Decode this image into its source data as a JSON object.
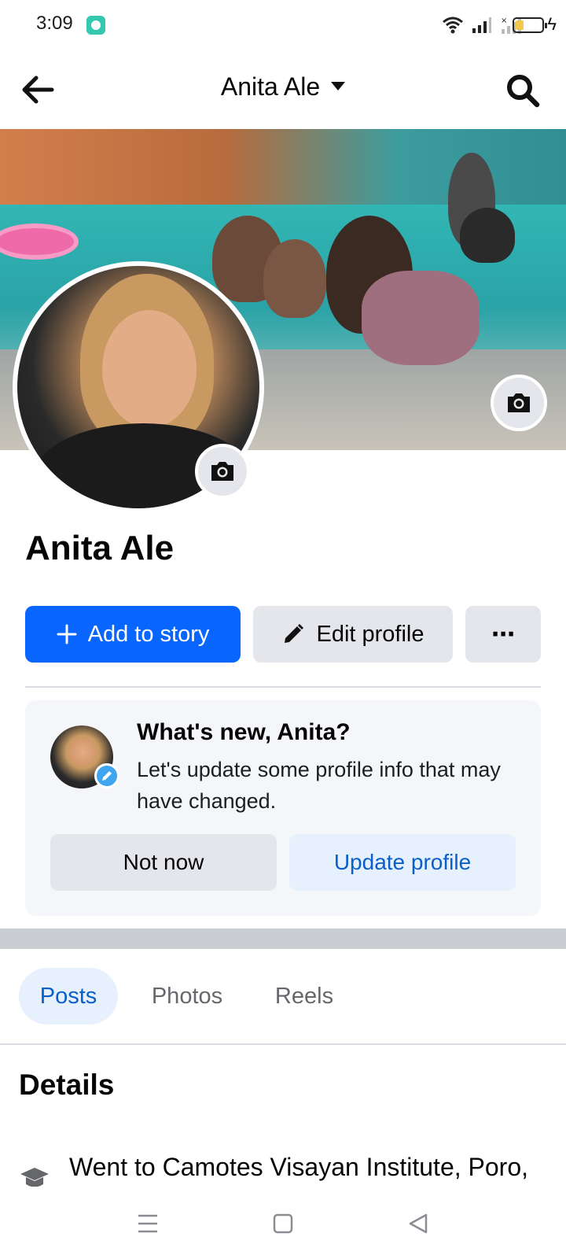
{
  "status_bar": {
    "time": "3:09",
    "icons": [
      "notification-app-icon",
      "wifi-icon",
      "signal-icon",
      "no-signal-icon",
      "battery-icon",
      "charging-icon"
    ]
  },
  "app_bar": {
    "title": "Anita Ale",
    "icons": [
      "back-arrow-icon",
      "caret-down-icon",
      "search-icon"
    ]
  },
  "profile": {
    "name": "Anita Ale"
  },
  "actions": {
    "add_story_label": "Add to story",
    "edit_profile_label": "Edit profile",
    "more_glyph": "⋯"
  },
  "prompt_card": {
    "title": "What's new, Anita?",
    "body": "Let's update some profile info that may have changed.",
    "not_now_label": "Not now",
    "update_label": "Update profile"
  },
  "tabs": [
    {
      "label": "Posts",
      "selected": true
    },
    {
      "label": "Photos",
      "selected": false
    },
    {
      "label": "Reels",
      "selected": false
    }
  ],
  "details": {
    "heading": "Details",
    "items": [
      {
        "icon": "graduation-cap-icon",
        "text": "Went to Camotes Visayan Institute, Poro, Cebu"
      }
    ]
  },
  "colors": {
    "primary_blue": "#0866ff",
    "light_blue_bg": "#e7f0fd",
    "blue_text": "#0a5fc9",
    "gray_button": "#e4e6eb",
    "card_bg": "#f4f6f9"
  }
}
